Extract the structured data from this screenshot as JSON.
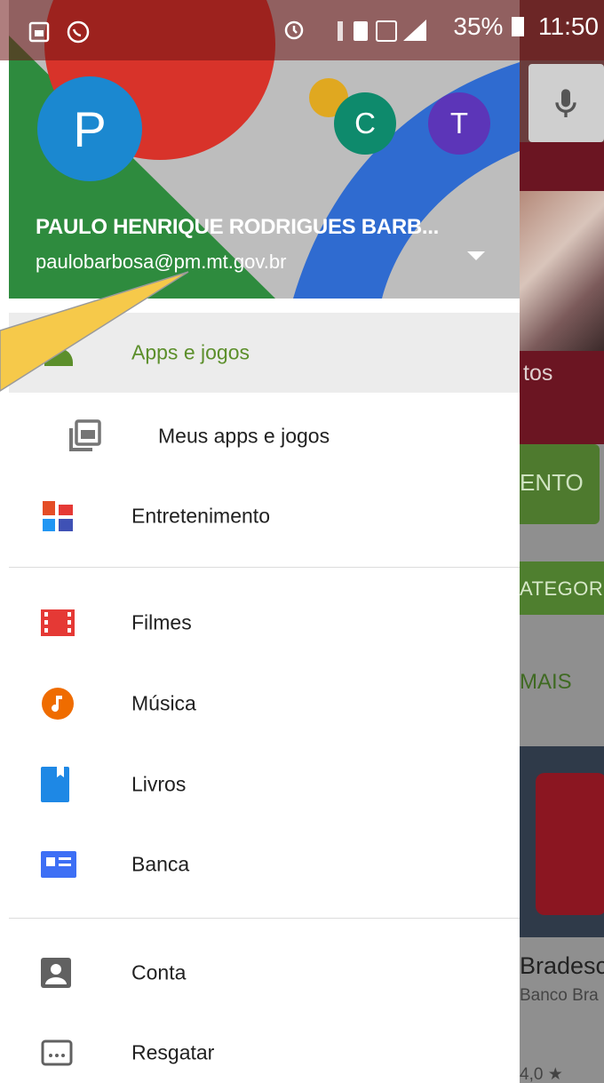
{
  "status_bar": {
    "battery": "35%",
    "time": "11:50"
  },
  "account": {
    "name": "PAULO HENRIQUE RODRIGUES BARB...",
    "email": "paulobarbosa@pm.mt.gov.br",
    "avatar_letter": "P",
    "other_accounts": [
      "C",
      "T"
    ]
  },
  "menu": {
    "apps_games": "Apps e jogos",
    "my_apps": "Meus apps e jogos",
    "entertainment": "Entretenimento",
    "movies": "Filmes",
    "music": "Música",
    "books": "Livros",
    "newsstand": "Banca",
    "account": "Conta",
    "redeem": "Resgatar"
  },
  "behind": {
    "banner_text": "tos",
    "button_text": "ENTO",
    "tab_categories": "ATEGOR",
    "tab_more": "MAIS",
    "app_name": "Bradesc",
    "app_publisher": "Banco Bra",
    "app_rating": "4,0 ★"
  },
  "colors": {
    "accent_green": "#5c8f2b",
    "avatar_blue": "#1b88d0",
    "avatar_teal": "#0e8a6c",
    "avatar_purple": "#5c35b8"
  }
}
